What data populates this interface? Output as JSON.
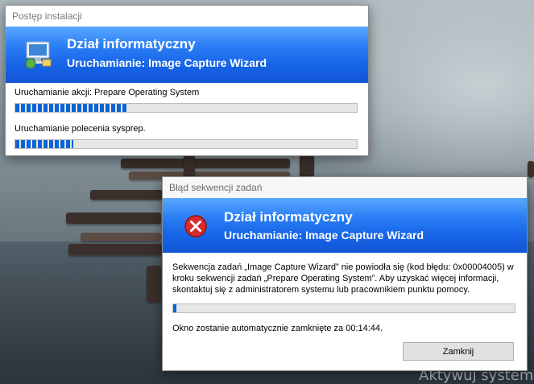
{
  "desktop": {
    "watermark": "Aktywuj system"
  },
  "progress_window": {
    "title": "Postęp instalacji",
    "banner_title": "Dział informatyczny",
    "banner_subtitle": "Uruchamianie: Image Capture Wizard",
    "action_label": "Uruchamianie akcji: Prepare Operating System",
    "action_progress": 0.33,
    "command_label": "Uruchamianie polecenia sysprep.",
    "command_progress": 0.17,
    "icon": "computer-install-icon"
  },
  "error_window": {
    "title": "Błąd sekwencji zadań",
    "banner_title": "Dział informatyczny",
    "banner_subtitle": "Uruchamianie: Image Capture Wizard",
    "message": "Sekwencja zadań „Image Capture Wizard” nie powiodła się (kod błędu: 0x00004005) w kroku sekwencji zadań „Prepare Operating System”. Aby uzyskać więcej informacji, skontaktuj się z administratorem systemu lub pracownikiem punktu pomocy.",
    "countdown_progress": 0.01,
    "countdown_text": "Okno zostanie automatycznie zamknięte za 00:14:44.",
    "close_button": "Zamknij",
    "icon": "error-icon"
  },
  "colors": {
    "banner_blue": "#1563e6",
    "progress_blue": "#0a64d6",
    "error_red": "#d62c2c"
  }
}
